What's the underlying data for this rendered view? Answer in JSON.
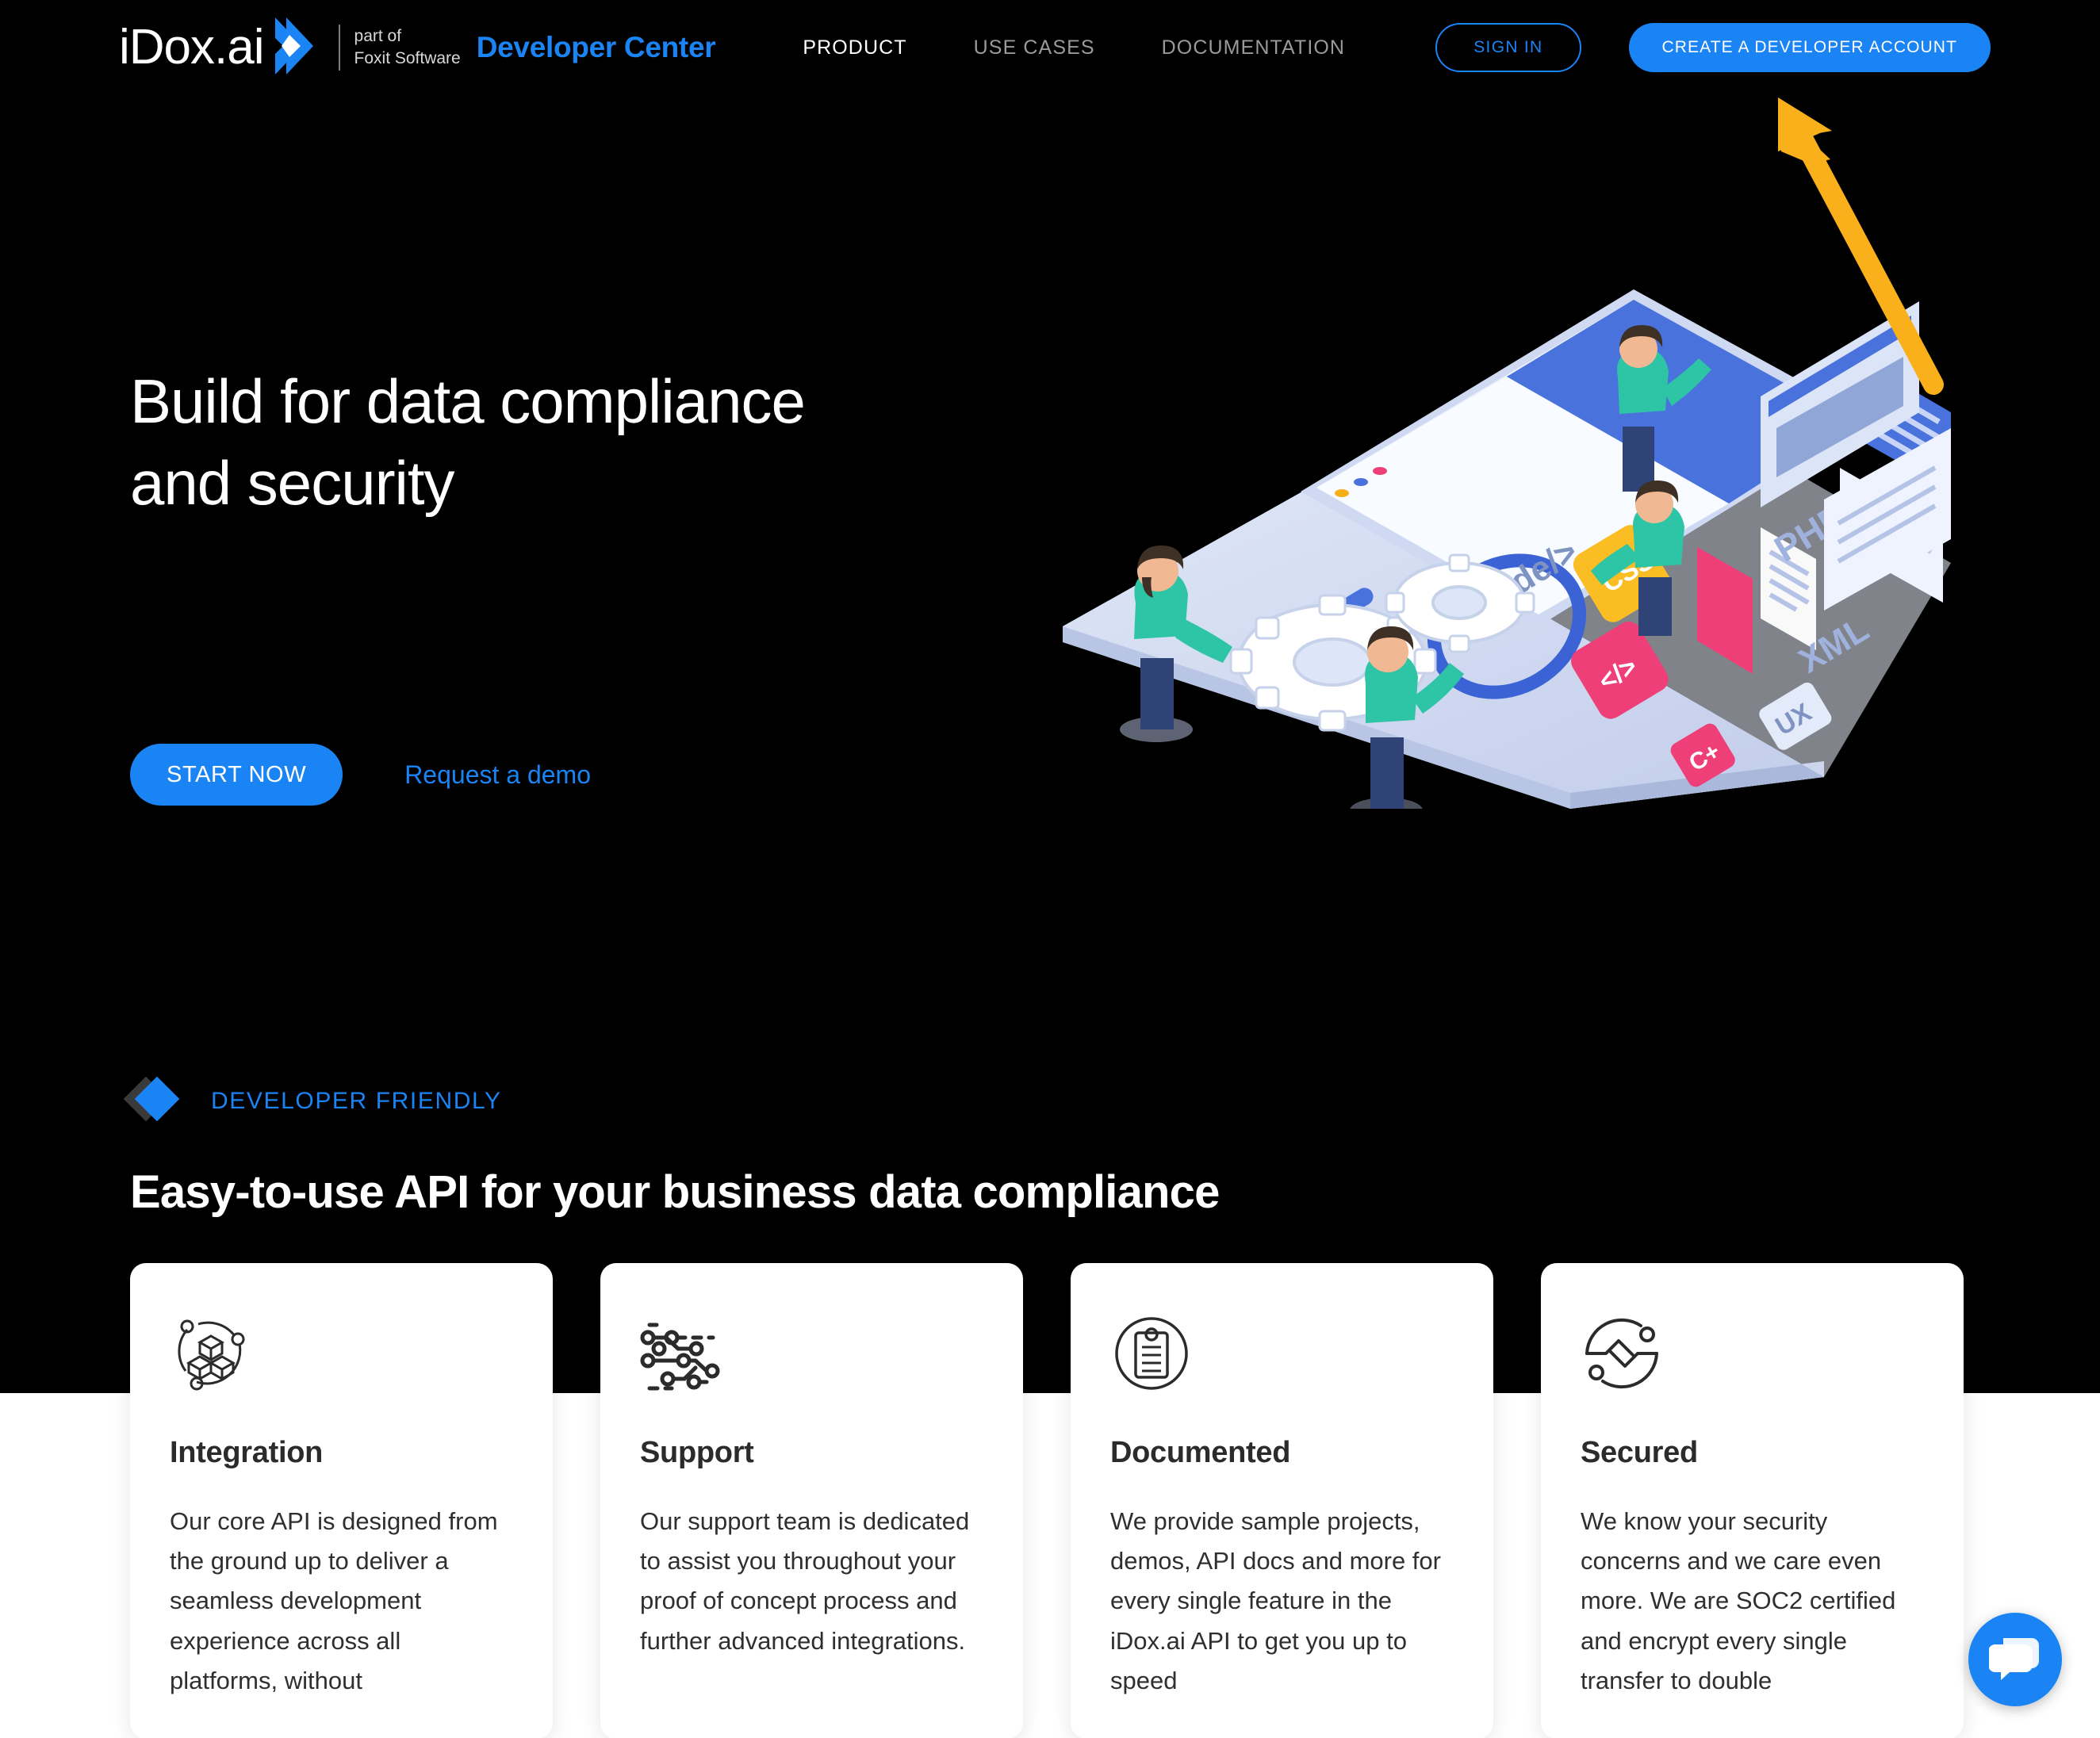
{
  "brand": {
    "logo_text": "iDox.ai",
    "logo_mark": "chevron-logo-icon",
    "part_of_line1": "part of",
    "part_of_line2": "Foxit Software",
    "developer_center": "Developer Center",
    "accent_blue": "#1a84f5",
    "arrow_orange": "#f5b017",
    "background_black": "#000000"
  },
  "nav": {
    "items": [
      {
        "label": "PRODUCT",
        "active": true
      },
      {
        "label": "USE CASES",
        "active": false
      },
      {
        "label": "DOCUMENTATION",
        "active": false
      }
    ],
    "sign_in": "SIGN IN",
    "create_account": "CREATE A DEVELOPER ACCOUNT"
  },
  "hero": {
    "title": "Build for data compliance and security",
    "start_now": "START NOW",
    "request_demo": "Request a demo",
    "illustration_labels": [
      "CSS",
      "PHP",
      "XML",
      "UX",
      "C+",
      "</>",
      "<code/>"
    ]
  },
  "annotation": {
    "arrow_name": "orange-arrow-pointing-to-create-account",
    "color": "#f5b017"
  },
  "section": {
    "eyebrow": "DEVELOPER FRIENDLY",
    "heading": "Easy-to-use API for your business data compliance"
  },
  "cards": [
    {
      "icon": "cubes-network-icon",
      "title": "Integration",
      "body": "Our core API is designed from the ground up to deliver a seamless development experience across all platforms, without"
    },
    {
      "icon": "circuit-nodes-icon",
      "title": "Support",
      "body": "Our support team is dedicated to assist you throughout your proof of concept process and further advanced integrations."
    },
    {
      "icon": "clipboard-circle-icon",
      "title": "Documented",
      "body": "We provide sample projects, demos, API docs and more for every single feature in the iDox.ai API to get you up to speed"
    },
    {
      "icon": "secure-zigzag-circle-icon",
      "title": "Secured",
      "body": "We know your security concerns and we care even more. We are SOC2 certified and encrypt every single transfer to double"
    }
  ],
  "chat": {
    "icon": "chat-bubbles-icon",
    "color": "#1a84f5"
  }
}
